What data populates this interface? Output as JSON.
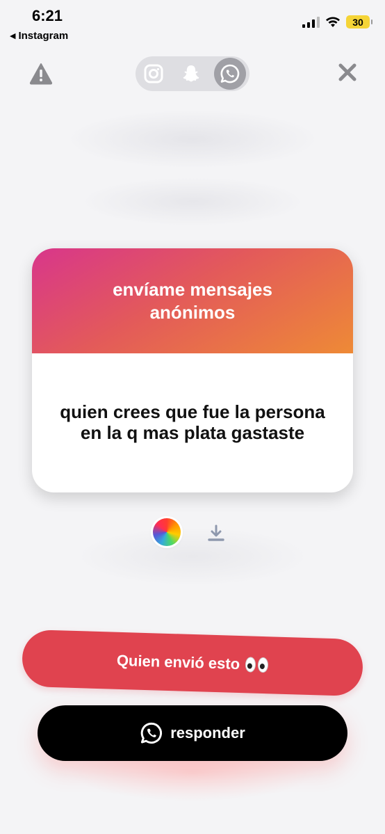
{
  "status_bar": {
    "time": "6:21",
    "back_app": "Instagram",
    "battery": "30"
  },
  "toolbar": {
    "warning_icon": "warning-triangle-icon",
    "close_icon": "close-x-icon",
    "platforms": [
      "instagram",
      "snapchat",
      "whatsapp"
    ],
    "selected_platform": "whatsapp"
  },
  "card": {
    "title": "envíame mensajes anónimos",
    "question": "quien crees que fue la persona en la q mas plata gastaste",
    "gradient_colors": [
      "#d8368b",
      "#e35a5a",
      "#ee8a36"
    ]
  },
  "tools": {
    "color_picker_icon": "color-wheel-icon",
    "download_icon": "download-icon"
  },
  "actions": {
    "who_sent_label": "Quien envió esto",
    "who_sent_color": "#e0434f",
    "reply_label": "responder",
    "reply_color": "#000000"
  }
}
